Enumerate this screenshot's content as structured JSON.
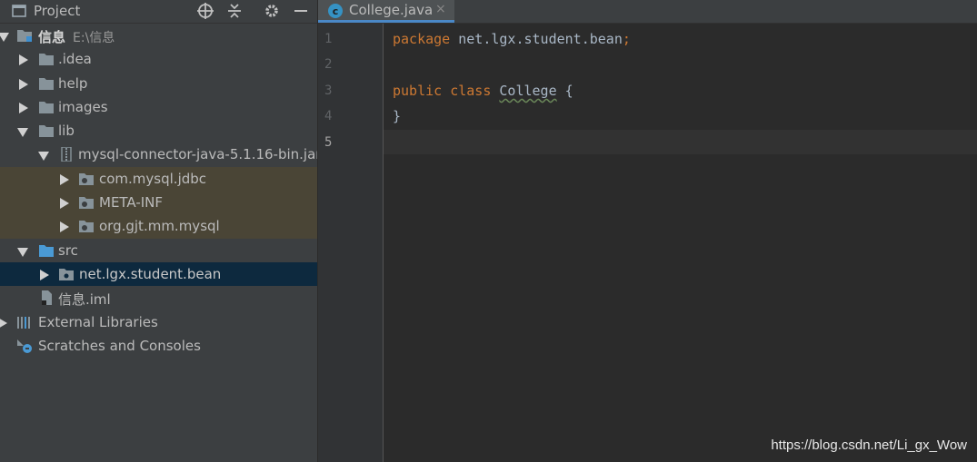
{
  "panel": {
    "title": "Project",
    "icons": [
      "locate-icon",
      "collapse-all-icon",
      "gear-icon",
      "hide-icon"
    ]
  },
  "tree": {
    "root": {
      "name": "信息",
      "path": "E:\\信息"
    },
    "idea": ".idea",
    "help": "help",
    "images": "images",
    "lib": "lib",
    "jar": "mysql-connector-java-5.1.16-bin.jar",
    "pkg1": "com.mysql.jdbc",
    "pkg2": "META-INF",
    "pkg3": "org.gjt.mm.mysql",
    "src": "src",
    "src_pkg": "net.lgx.student.bean",
    "iml": "信息.iml",
    "external": "External Libraries",
    "scratches": "Scratches and Consoles"
  },
  "editor": {
    "tab_label": "College.java",
    "tab_close": "×",
    "line_numbers": [
      "1",
      "2",
      "3",
      "4",
      "5"
    ],
    "code": {
      "l1_kw": "package",
      "l1_rest": " net.lgx.student.bean",
      "l1_semi": ";",
      "l3_kw1": "public",
      "l3_kw2": "class",
      "l3_name": "College",
      "l3_brace": " {",
      "l4": "}"
    }
  },
  "colors": {
    "keyword": "#cc7832",
    "text": "#a9b7c6",
    "panel_bg": "#3c3f41",
    "editor_bg": "#2b2b2b",
    "selection": "#0d293e",
    "library_bg": "#4a4536"
  },
  "watermark": "https://blog.csdn.net/Li_gx_Wow"
}
